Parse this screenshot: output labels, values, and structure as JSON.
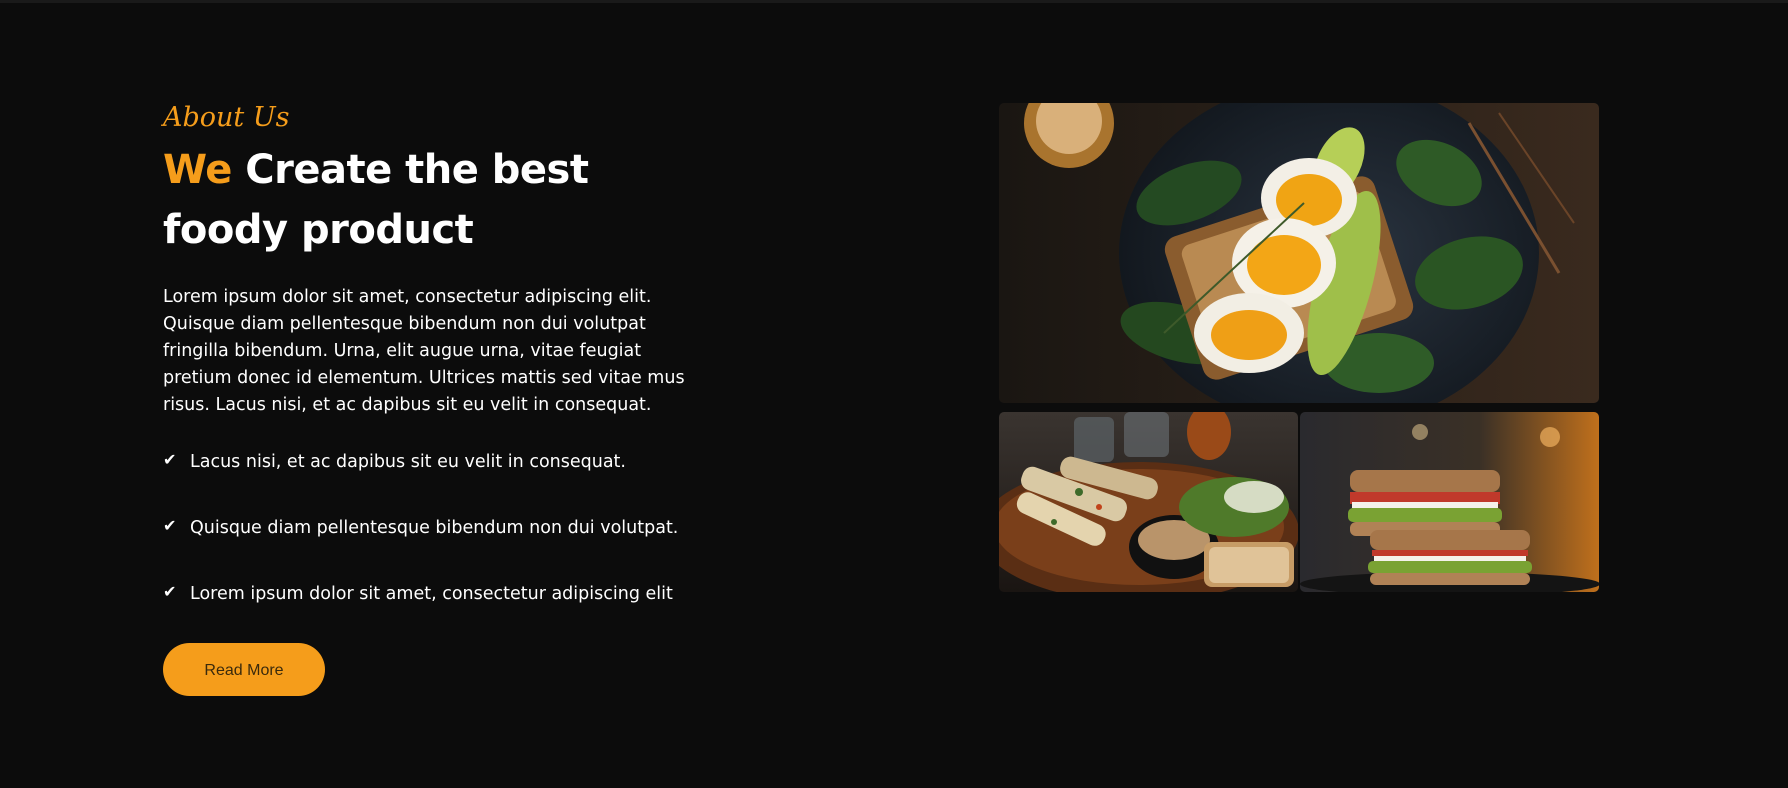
{
  "about": {
    "eyebrow": "About Us",
    "headline_accent": "We",
    "headline_line1": "Create the best",
    "headline_line2": "foody product",
    "description": "Lorem ipsum dolor sit amet, consectetur adipiscing elit. Quisque diam pellentesque bibendum non dui volutpat fringilla bibendum. Urna, elit augue urna, vitae feugiat pretium donec id elementum. Ultrices mattis sed vitae mus risus. Lacus nisi, et ac dapibus sit eu velit in consequat.",
    "features": [
      {
        "icon": "check-icon",
        "text": "Lacus nisi, et ac dapibus sit eu velit in consequat."
      },
      {
        "icon": "check-icon",
        "text": "Quisque diam pellentesque bibendum non dui volutpat."
      },
      {
        "icon": "check-icon",
        "text": "Lorem ipsum dolor sit amet, consectetur adipiscing elit"
      }
    ],
    "button_label": "Read More"
  },
  "gallery": {
    "photos": [
      {
        "name": "egg-avocado-toast-photo"
      },
      {
        "name": "grilled-platter-photo"
      },
      {
        "name": "sandwich-photo"
      }
    ]
  },
  "colors": {
    "background": "#0c0c0c",
    "accent": "#f59d1b",
    "text": "#ffffff"
  }
}
